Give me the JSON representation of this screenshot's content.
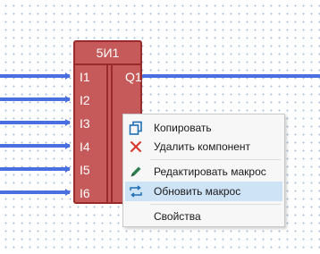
{
  "block": {
    "title": "5И1",
    "inputs": [
      "I1",
      "I2",
      "I3",
      "I4",
      "I5",
      "I6"
    ],
    "outputs": [
      "Q1"
    ]
  },
  "context_menu": {
    "items": [
      {
        "label": "Копировать",
        "icon": "copy-icon"
      },
      {
        "label": "Удалить компонент",
        "icon": "delete-icon"
      },
      {
        "label": "Редактировать макрос",
        "icon": "edit-icon"
      },
      {
        "label": "Обновить макрос",
        "icon": "refresh-icon",
        "highlighted": true
      },
      {
        "label": "Свойства",
        "icon": ""
      }
    ]
  },
  "colors": {
    "wire": "#4a6fe0",
    "block_fill": "#c65a5a",
    "block_border": "#9b2b2b",
    "menu_highlight": "#cfe3f7",
    "delete_icon": "#d9342b",
    "copy_icon": "#1f6fb5",
    "edit_icon": "#2e7d4f"
  }
}
